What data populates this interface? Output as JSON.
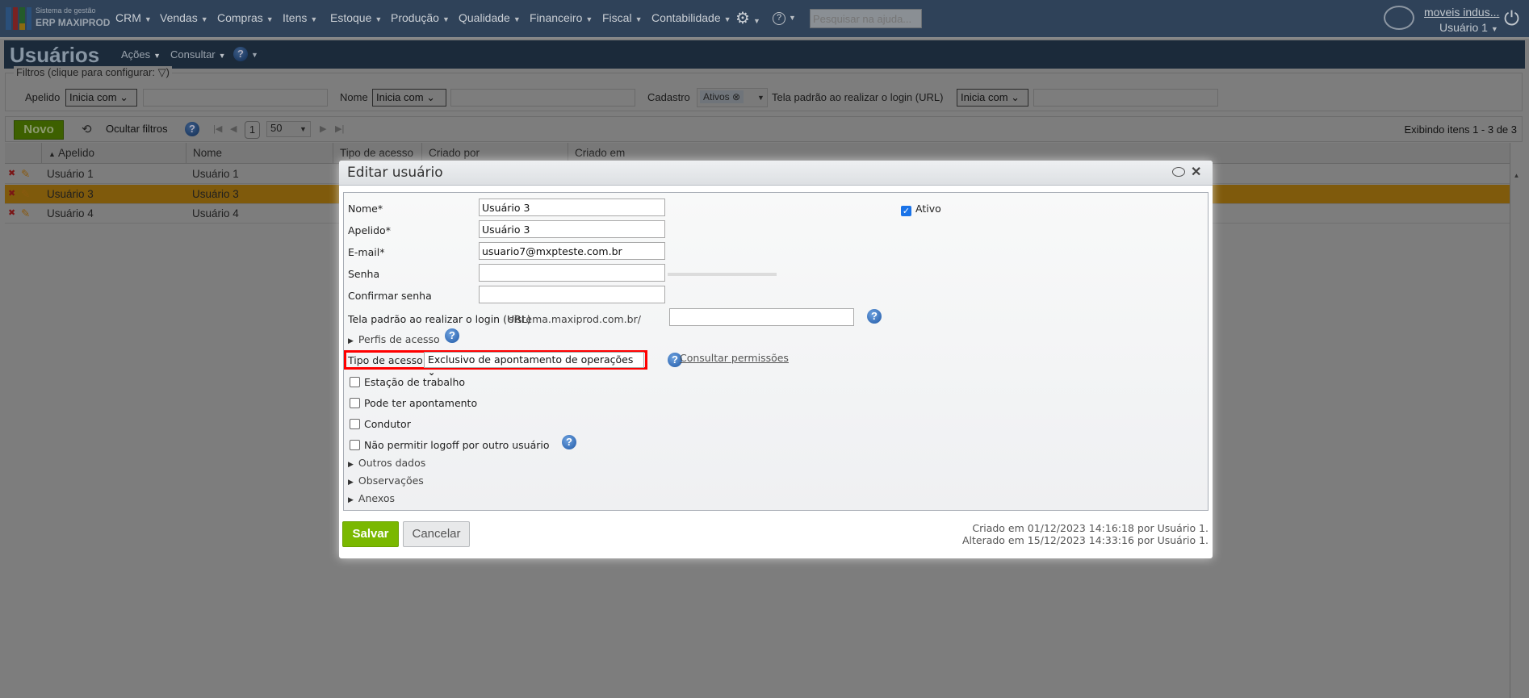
{
  "app": {
    "brand_line1": "Sistema de gestão",
    "brand_line2": "ERP MAXIPROD"
  },
  "nav": {
    "items": [
      "CRM",
      "Vendas",
      "Compras",
      "Itens",
      "Estoque",
      "Produção",
      "Qualidade",
      "Financeiro",
      "Fiscal",
      "Contabilidade"
    ],
    "search_placeholder": "Pesquisar na ajuda...",
    "company": "moveis indus...",
    "user": "Usuário 1"
  },
  "page": {
    "title": "Usuários",
    "actions": "Ações",
    "consult": "Consultar"
  },
  "filters": {
    "legend": "Filtros (clique para configurar:",
    "legend_end": ")",
    "apelido_label": "Apelido",
    "apelido_op": "Inicia com",
    "nome_label": "Nome",
    "nome_op": "Inicia com",
    "cadastro_label": "Cadastro",
    "cadastro_chip": "Ativos",
    "url_label": "Tela padrão ao realizar o login (URL)",
    "url_op": "Inicia com"
  },
  "toolbar": {
    "new": "Novo",
    "hide_filters": "Ocultar filtros",
    "page": "1",
    "page_size": "50",
    "showing": "Exibindo itens 1 - 3 de 3"
  },
  "grid": {
    "columns": [
      "Apelido",
      "Nome",
      "Tipo de acesso",
      "Criado por",
      "Criado em"
    ],
    "rows": [
      {
        "apelido": "Usuário 1",
        "nome": "Usuário 1"
      },
      {
        "apelido": "Usuário 3",
        "nome": "Usuário 3"
      },
      {
        "apelido": "Usuário 4",
        "nome": "Usuário 4"
      }
    ]
  },
  "modal": {
    "title": "Editar usuário",
    "nome_label": "Nome*",
    "nome": "Usuário 3",
    "apelido_label": "Apelido*",
    "apelido": "Usuário 3",
    "email_label": "E-mail*",
    "email": "usuario7@mxpteste.com.br",
    "senha_label": "Senha",
    "confirm_label": "Confirmar senha",
    "url_label": "Tela padrão ao realizar o login (URL)",
    "url_prefix": "sistema.maxiprod.com.br/",
    "perfis": "Perfis de acesso",
    "tipo_label": "Tipo de acesso",
    "tipo_value": "Exclusivo de apontamento de operações",
    "consultar": "Consultar permissões",
    "ativo": "Ativo",
    "checks": [
      "Estação de trabalho",
      "Pode ter apontamento",
      "Condutor",
      "Não permitir logoff por outro usuário"
    ],
    "sections": [
      "Outros dados",
      "Observações",
      "Anexos"
    ],
    "save": "Salvar",
    "cancel": "Cancelar",
    "created": "Criado em 01/12/2023 14:16:18 por Usuário 1.",
    "altered": "Alterado em 15/12/2023 14:33:16 por Usuário 1."
  },
  "colors": {
    "nav": "#2f4259",
    "title": "#1b2a3a",
    "selected_row": "#7f5a0c",
    "save": "#7ab800",
    "highlight": "#ff0000"
  }
}
